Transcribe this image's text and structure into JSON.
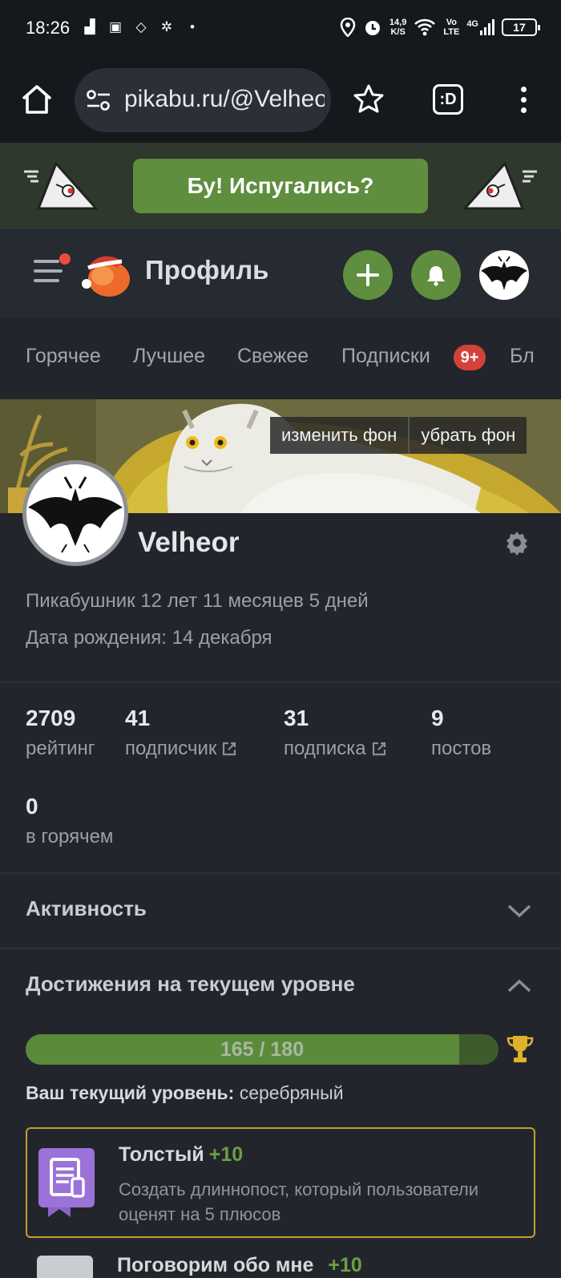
{
  "status_bar": {
    "time": "18:26",
    "net_speed_value": "14,9",
    "net_speed_unit": "K/S",
    "volte_top": "Vo",
    "volte_bottom": "LTE",
    "signal": "4G",
    "battery": "17"
  },
  "browser": {
    "url": "pikabu.ru/@Velheor",
    "tabs_label": ":D"
  },
  "promo": {
    "button_label": "Бу! Испугались?"
  },
  "header": {
    "title": "Профиль"
  },
  "nav": {
    "tabs": [
      "Горячее",
      "Лучшее",
      "Свежее",
      "Подписки",
      "Бл"
    ],
    "subs_badge": "9+"
  },
  "cover": {
    "change_bg": "изменить фон",
    "remove_bg": "убрать фон"
  },
  "profile": {
    "username": "Velheor",
    "member_since": "Пикабушник 12 лет 11 месяцев 5 дней",
    "birthday": "Дата рождения: 14 декабря"
  },
  "stats": [
    {
      "value": "2709",
      "label": "рейтинг"
    },
    {
      "value": "41",
      "label": "подписчик"
    },
    {
      "value": "31",
      "label": "подписка"
    },
    {
      "value": "9",
      "label": "постов"
    },
    {
      "value": "0",
      "label": "в горячем"
    }
  ],
  "activity": {
    "title": "Активность"
  },
  "achievements": {
    "title": "Достижения на текущем уровне",
    "progress_text": "165 / 180",
    "progress_fraction": 0.9167,
    "level_label": "Ваш текущий уровень:",
    "level_value": "серебряный",
    "items": [
      {
        "name": "Толстый",
        "points": "+10",
        "description": "Создать длиннопост, который пользователи оценят на 5 плюсов"
      },
      {
        "name": "Поговорим обо мне",
        "points": "+10"
      }
    ]
  },
  "colors": {
    "accent_green": "#5e8e3e",
    "badge_red": "#d5413a",
    "card_gold": "#c0a02e"
  }
}
